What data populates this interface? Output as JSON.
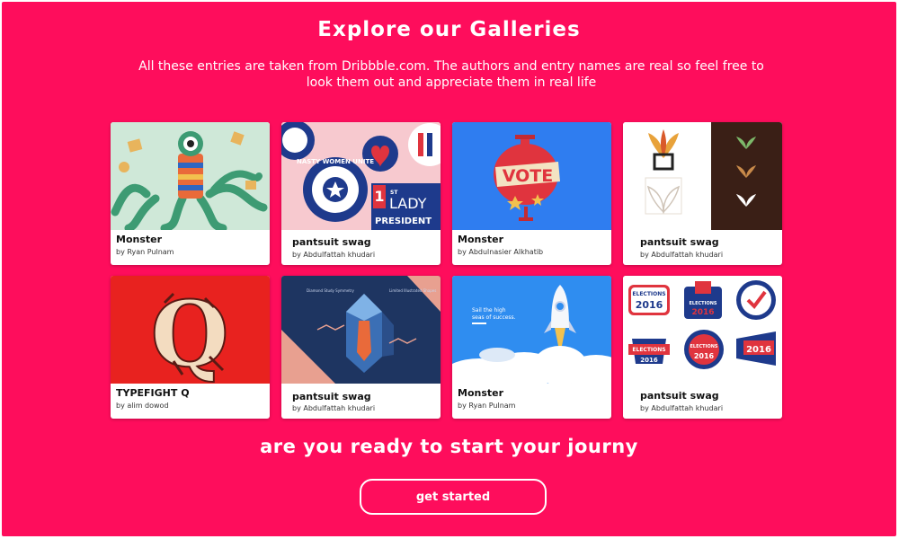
{
  "header": {
    "title": "Explore our Galleries",
    "subtitle": "All these entries are taken from Dribbble.com. The authors and entry names are real so feel free to look them out and appreciate them in real life"
  },
  "gallery": {
    "cards": [
      {
        "name": "Monster",
        "author": "by Ryan Pulnam",
        "art": "octopus-monster"
      },
      {
        "name": "pantsuit swag",
        "author": "by Abdulfattah khudari",
        "art": "election-badges"
      },
      {
        "name": "Monster",
        "author": "by Abdulnasier Alkhatib",
        "art": "vote-balloon"
      },
      {
        "name": "pantsuit swag",
        "author": "by Abdulfattah khudari",
        "art": "plant-logos"
      },
      {
        "name": "TYPEFIGHT Q",
        "author": "by alim dowod",
        "art": "blackletter-q"
      },
      {
        "name": "pantsuit swag",
        "author": "by Abdulfattah khudari",
        "art": "crystal-poster"
      },
      {
        "name": "Monster",
        "author": "by Ryan Pulnam",
        "art": "rocket-launch"
      },
      {
        "name": "pantsuit swag",
        "author": "by Abdulfattah khudari",
        "art": "elections-2016-stickers"
      }
    ]
  },
  "art_text": {
    "lady_1st": "1",
    "lady_st": "ST",
    "lady": "LADY",
    "president": "PRESIDENT",
    "nasty_women": "NASTY WOMEN UNITE",
    "vote": "VOTE",
    "q_letter": "Q",
    "poster_left": "Diamond Study Symmetry",
    "poster_right": "Limited Illustrated Shapes",
    "rocket_caption_1": "Sail the high",
    "rocket_caption_2": "seas of success.",
    "elections": "ELECTIONS",
    "year": "2016"
  },
  "cta_section": {
    "heading": "are you ready to start your journy",
    "button_label": "get started"
  },
  "colors": {
    "background": "#fe0d5c",
    "card": "#ffffff",
    "text_on_bg": "#ffffff",
    "badge_red": "#e0343e",
    "badge_blue": "#1e3a8c"
  }
}
